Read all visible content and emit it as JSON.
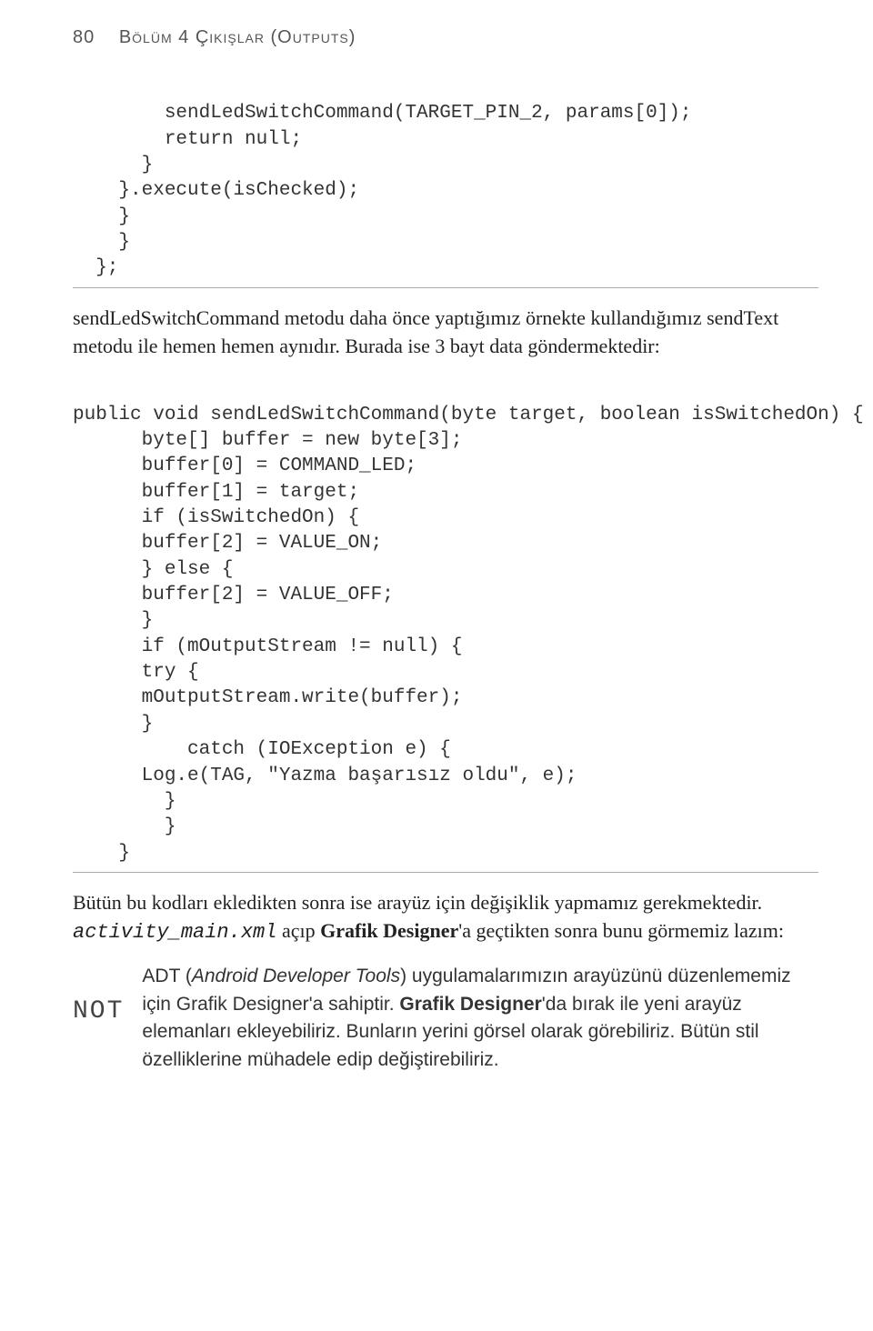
{
  "header": {
    "page_number": "80",
    "chapter": "Bölüm 4   Çıkışlar (Outputs)"
  },
  "code1": {
    "l1": "        sendLedSwitchCommand(TARGET_PIN_2, params[0]);",
    "l2": "        return null;",
    "l3": "      }",
    "l4": "    }.execute(isChecked);",
    "l5": "    }",
    "l6": "    }",
    "l7": "  };"
  },
  "para1_a": "sendLedSwitchCommand metodu daha önce yaptığımız örnekte kullandığımız sendText metodu ile hemen hemen aynıdır. Burada ise 3 bayt data göndermektedir:",
  "code2": {
    "l1": "public void sendLedSwitchCommand(byte target, boolean isSwitchedOn) {",
    "l2": "      byte[] buffer = new byte[3];",
    "l3": "      buffer[0] = COMMAND_LED;",
    "l4": "      buffer[1] = target;",
    "l5": "      if (isSwitchedOn) {",
    "l6": "      buffer[2] = VALUE_ON;",
    "l7": "      } else {",
    "l8": "      buffer[2] = VALUE_OFF;",
    "l9": "      }",
    "l10": "      if (mOutputStream != null) {",
    "l11": "      try {",
    "l12": "      mOutputStream.write(buffer);",
    "l13": "      }",
    "l14": "          catch (IOException e) {",
    "l15": "      Log.e(TAG, \"Yazma başarısız oldu\", e);",
    "l16": "        }",
    "l17": "        }",
    "l18": "    }"
  },
  "para2_plain1": "Bütün bu kodları ekledikten sonra ise arayüz için değişiklik yapmamız gerekmektedir. ",
  "para2_mono": "activity_main.xml",
  "para2_plain2": " açıp ",
  "para2_bold": "Grafik Designer",
  "para2_plain3": "'a geçtikten sonra bunu görmemiz lazım:",
  "note": {
    "tag": "NOT",
    "t1": "ADT (",
    "t_ital": "Android Developer Tools",
    "t2": ") uygulamalarımızın arayüzünü düzenlememiz için Grafik Designer'a sahiptir. ",
    "t_bold": "Grafik Designer",
    "t3": "'da bırak ile yeni arayüz elemanları ekleyebiliriz. Bunların yerini görsel olarak görebiliriz. Bütün stil özelliklerine mühadele edip değiştirebiliriz."
  }
}
